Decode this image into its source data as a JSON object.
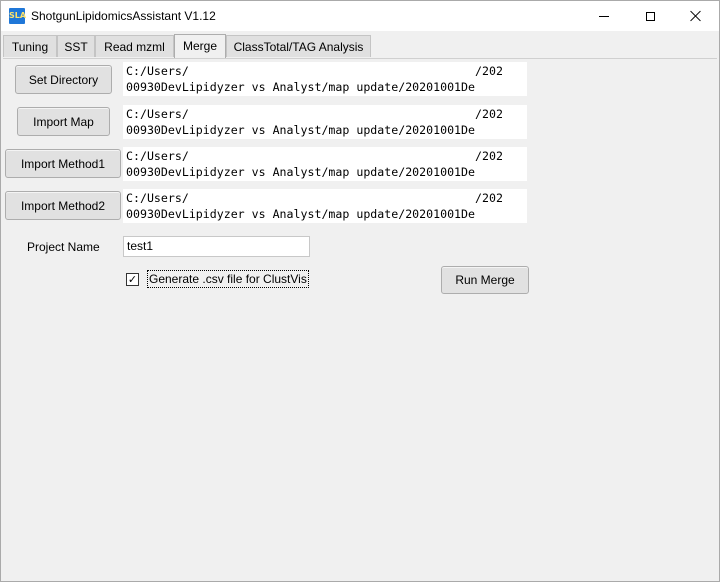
{
  "window": {
    "title": "ShotgunLipidomicsAssistant V1.12",
    "app_icon_text": "SLA",
    "icons": [
      "app-icon",
      "minimize-icon",
      "maximize-icon",
      "close-icon"
    ]
  },
  "tabs": [
    {
      "label": "Tuning",
      "active": false
    },
    {
      "label": "SST",
      "active": false
    },
    {
      "label": "Read mzml",
      "active": false
    },
    {
      "label": "Merge",
      "active": true
    },
    {
      "label": "ClassTotal/TAG Analysis",
      "active": false
    }
  ],
  "merge": {
    "set_directory": {
      "button_label": "Set Directory",
      "path_line1": "C:/Users/                                         /202",
      "path_line2": "00930DevLipidyzer vs Analyst/map update/20201001De"
    },
    "import_map": {
      "button_label": "Import Map",
      "path_line1": "C:/Users/                                         /202",
      "path_line2": "00930DevLipidyzer vs Analyst/map update/20201001De"
    },
    "import_method1": {
      "button_label": "Import Method1",
      "path_line1": "C:/Users/                                         /202",
      "path_line2": "00930DevLipidyzer vs Analyst/map update/20201001De"
    },
    "import_method2": {
      "button_label": "Import Method2",
      "path_line1": "C:/Users/                                         /202",
      "path_line2": "00930DevLipidyzer vs Analyst/map update/20201001De"
    },
    "project_name_label": "Project Name",
    "project_name_value": "test1",
    "csv_checkbox_label": "Generate .csv file for ClustVis",
    "csv_checkbox_checked": true,
    "check_mark": "✓",
    "run_button_label": "Run Merge"
  }
}
